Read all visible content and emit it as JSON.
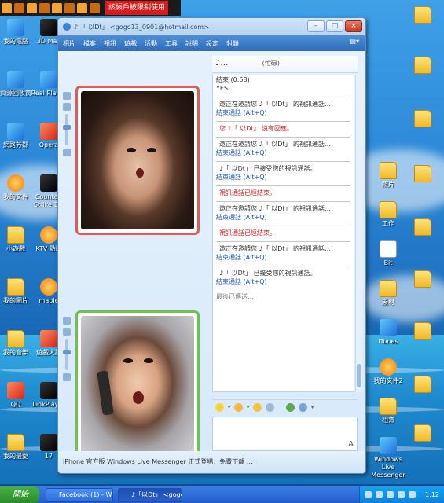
{
  "topbar": {
    "warning_text": "該帳戶被限制使用"
  },
  "desktop_left": [
    {
      "label": "我的電腦",
      "icon": "computer-icon"
    },
    {
      "label": "資源回收筒",
      "icon": "recycle-bin-icon"
    },
    {
      "label": "網路芳鄰",
      "icon": "network-icon"
    },
    {
      "label": "我的文件",
      "icon": "documents-icon"
    },
    {
      "label": "小遊戲",
      "icon": "folder-icon"
    },
    {
      "label": "我的圖片",
      "icon": "folder-icon"
    },
    {
      "label": "我的音樂",
      "icon": "folder-icon"
    },
    {
      "label": "QQ",
      "icon": "qq-icon"
    },
    {
      "label": "我的最愛",
      "icon": "folder-icon"
    }
  ],
  "desktop_left2": [
    {
      "label": "3D Max",
      "icon": "app-icon"
    },
    {
      "label": "Real Player",
      "icon": "app-icon"
    },
    {
      "label": "Opera",
      "icon": "app-icon"
    },
    {
      "label": "Counter-Strike 1.6",
      "icon": "game-icon"
    },
    {
      "label": "KTV 點歌",
      "icon": "app-icon"
    },
    {
      "label": "maple",
      "icon": "game-icon"
    },
    {
      "label": "遊戲大廳",
      "icon": "game-icon"
    },
    {
      "label": "LinkPlayer",
      "icon": "app-icon"
    },
    {
      "label": "17",
      "icon": "app-icon"
    }
  ],
  "desktop_right": [
    {
      "label": "照片",
      "icon": "folder-icon"
    },
    {
      "label": "工作",
      "icon": "folder-icon"
    },
    {
      "label": "Bit",
      "icon": "folder-icon"
    },
    {
      "label": "素材",
      "icon": "folder-icon"
    },
    {
      "label": "ITunes",
      "icon": "folder-icon"
    },
    {
      "label": "我的文件2",
      "icon": "document-icon"
    },
    {
      "label": "相簿",
      "icon": "folder-icon"
    },
    {
      "label": "Windows Live Messenger",
      "icon": "messenger-icon"
    }
  ],
  "window": {
    "title": "♪ 「 以Dt」 <gogo13_0901@hotmail.com>",
    "menu": [
      "相片",
      "檔案",
      "視訊",
      "遊戲",
      "活動",
      "工具",
      "說明",
      "設定",
      "封鎖"
    ],
    "contact_name": "♪…",
    "contact_status": "(忙碌)",
    "footer_text": "iPhone 官方版 Windows Live Messenger 正式登場，免費下載 …"
  },
  "messages": [
    {
      "text": "結束 (0:58)",
      "kind": "normal"
    },
    {
      "text": "YES",
      "kind": "normal"
    },
    {
      "text": "邀正在邀請您 ♪「 以Dt」 的視訊通話…",
      "kind": "sep"
    },
    {
      "text": "結束通話 (Alt+Q)",
      "kind": "link"
    },
    {
      "text": "您 ♪「 以Dt」 沒有回應。",
      "kind": "red"
    },
    {
      "text": "邀正在邀請您 ♪「 以Dt」 的視訊通話…",
      "kind": "sep"
    },
    {
      "text": "結束通話 (Alt+Q)",
      "kind": "link"
    },
    {
      "text": "♪「 以Dt」 已接受您的視訊通話。",
      "kind": "sep"
    },
    {
      "text": "結束通話 (Alt+Q)",
      "kind": "link"
    },
    {
      "text": "視訊通話已經結束。",
      "kind": "red"
    },
    {
      "text": "邀正在邀請您 ♪「 以Dt」 的視訊通話…",
      "kind": "sep"
    },
    {
      "text": "結束通話 (Alt+Q)",
      "kind": "link"
    },
    {
      "text": "視訊通話已經結束。",
      "kind": "red"
    },
    {
      "text": "邀正在邀請您 ♪「 以Dt」 的視訊通話…",
      "kind": "sep"
    },
    {
      "text": "結束通話 (Alt+Q)",
      "kind": "link"
    },
    {
      "text": "♪「 以Dt」 已接受您的視訊通話。",
      "kind": "sep"
    },
    {
      "text": "結束通話 (Alt+Q)",
      "kind": "link"
    },
    {
      "text": "最後已傳送…",
      "kind": "status"
    }
  ],
  "taskbar": {
    "start_label": "開始",
    "tasks": [
      "Facebook (1) - Windo…",
      "♪「以Dt」 <gogo13…"
    ],
    "time": "1:12"
  },
  "colors": {
    "frame_top": "#e25a58",
    "frame_bottom": "#6fc24a",
    "menubar": "#2e6cb8",
    "warning": "#d81c1c"
  }
}
